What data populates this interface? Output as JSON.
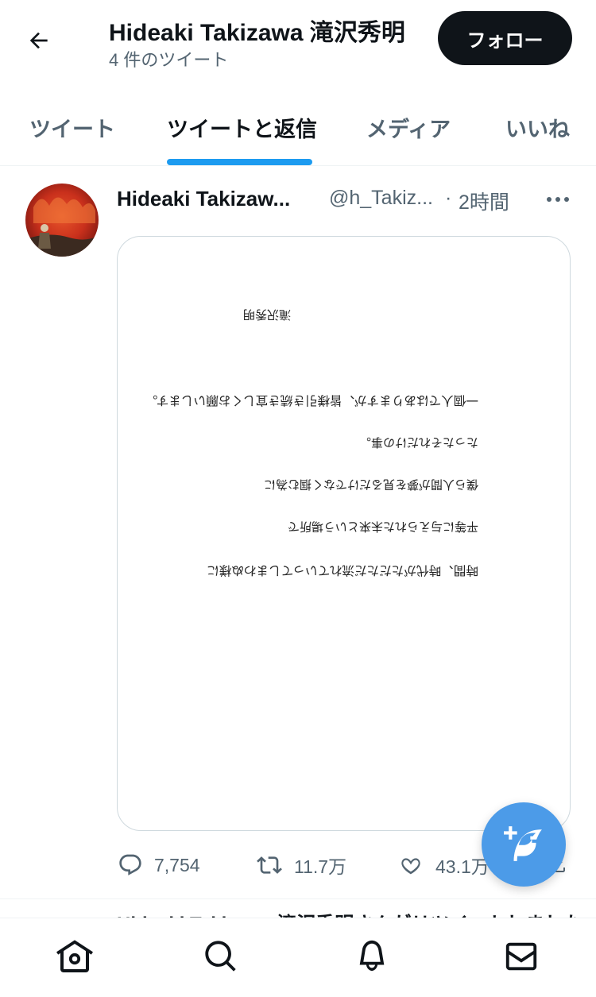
{
  "header": {
    "title": "Hideaki Takizawa 滝沢秀明",
    "subtitle": "4 件のツイート",
    "follow_label": "フォロー"
  },
  "tabs": [
    {
      "label": "ツイート"
    },
    {
      "label": "ツイートと返信"
    },
    {
      "label": "メディア"
    },
    {
      "label": "いいね"
    }
  ],
  "active_tab": "ツイートと返信",
  "tweet": {
    "name": "Hideaki Takizaw...",
    "handle": "@h_Takiz...",
    "separator": "·",
    "time": "2時間",
    "letter": {
      "lines": [
        "時間、時代がただただ流れていってしまわぬ様に",
        "平等に与えられた未来という場所で",
        "僕ら人間が夢を見るだけでなく掴む為に",
        "たったそれだけの事。",
        "一個人ではありますが、皆様引き続き宜しくお願いします。"
      ],
      "signature": "滝沢秀明"
    },
    "stats": {
      "replies": "7,754",
      "retweets": "11.7万",
      "likes": "43.1万"
    }
  },
  "next_tweet_preview": "Hideaki Takizawa 滝沢秀明さんがリツイートしました",
  "icons": {
    "back": "arrow-left-icon",
    "more": "more-icon",
    "reply": "reply-icon",
    "retweet": "retweet-icon",
    "like": "heart-icon",
    "share": "share-icon",
    "compose": "compose-tweet-icon",
    "nav": [
      "home-icon",
      "search-icon",
      "bell-icon",
      "mail-icon"
    ]
  },
  "colors": {
    "accent": "#1d9bf0",
    "fab": "#4c9be8",
    "text": "#0f1419",
    "secondary": "#536471"
  }
}
